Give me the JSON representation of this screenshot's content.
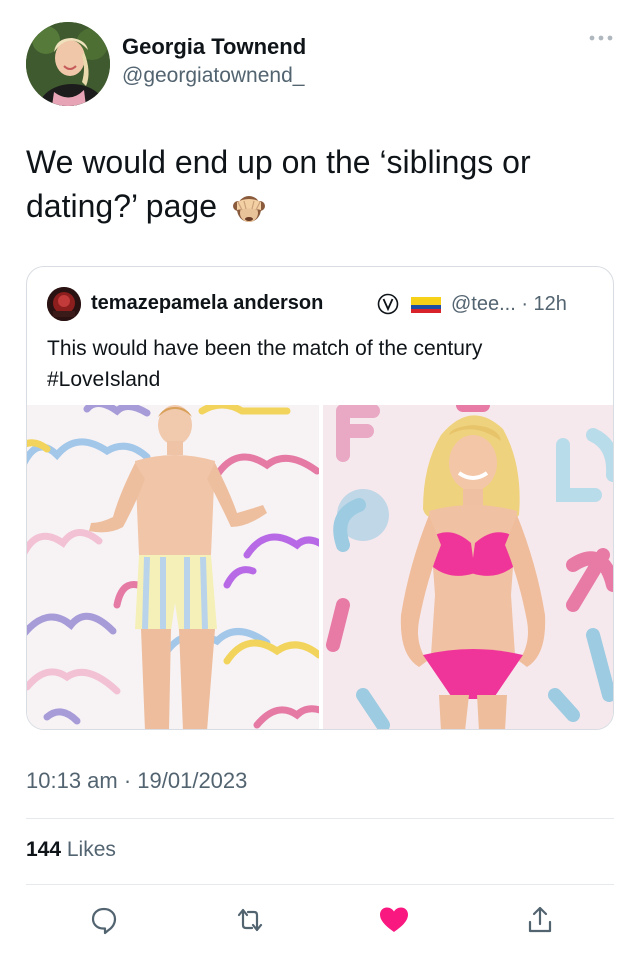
{
  "author": {
    "name": "Georgia Townend",
    "handle": "@georgiatownend_",
    "avatar_icon": "profile-photo-woman"
  },
  "more_icon": "ellipsis-icon",
  "tweet": {
    "text": "We would end up on the ‘siblings or dating?’ page",
    "emoji_icon": "see-no-evil-monkey-emoji"
  },
  "quoted_tweet": {
    "name": "temazepamela anderson",
    "verified_icon": "circled-v-emoji",
    "flag_icon": "colombia-flag-emoji",
    "handle_time": "@tee... · 12h",
    "text_line1": "This would have been the match of the century",
    "text_line2": "#LoveIsland",
    "media": [
      {
        "icon": "photo-man-in-swim-shorts"
      },
      {
        "icon": "photo-woman-in-pink-bikini"
      }
    ]
  },
  "timestamp": "10:13 am · 19/01/2023",
  "likes": {
    "count": "144",
    "label": " Likes"
  },
  "actions": [
    {
      "icon": "reply-icon"
    },
    {
      "icon": "retweet-icon"
    },
    {
      "icon": "like-icon-filled"
    },
    {
      "icon": "share-icon"
    }
  ],
  "colors": {
    "text": "#0f1419",
    "secondary": "#536471",
    "like_active": "#f91880",
    "border": "#d7dde2"
  }
}
